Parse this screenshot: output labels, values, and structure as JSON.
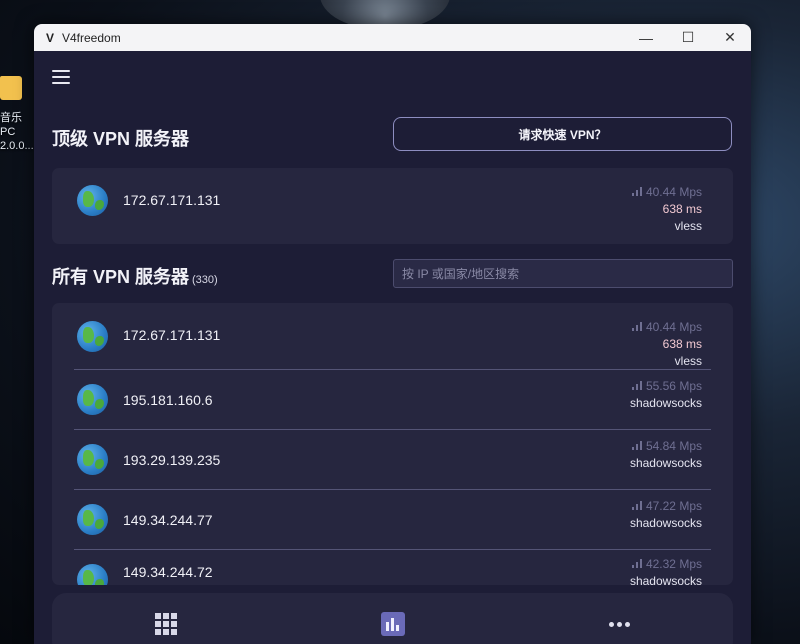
{
  "desktop": {
    "folder_label": "音乐PC 2.0.0..."
  },
  "window": {
    "title": "V4freedom",
    "logo": "V",
    "minimize": "—",
    "maximize": "☐",
    "close": "✕"
  },
  "top_section": {
    "title": "顶级 VPN 服务器",
    "quick_button": "请求快速 VPN？",
    "server": {
      "ip": "172.67.171.131",
      "speed": "40.44 Mps",
      "latency": "638 ms",
      "protocol": "vless"
    }
  },
  "all_section": {
    "title": "所有 VPN 服务器",
    "count": "(330)",
    "search_placeholder": "按 IP 或国家/地区搜索",
    "servers": [
      {
        "ip": "172.67.171.131",
        "speed": "40.44 Mps",
        "latency": "638 ms",
        "protocol": "vless"
      },
      {
        "ip": "195.181.160.6",
        "speed": "55.56 Mps",
        "protocol": "shadowsocks"
      },
      {
        "ip": "193.29.139.235",
        "speed": "54.84 Mps",
        "protocol": "shadowsocks"
      },
      {
        "ip": "149.34.244.77",
        "speed": "47.22 Mps",
        "protocol": "shadowsocks"
      },
      {
        "ip": "149.34.244.72",
        "speed": "42.32 Mps",
        "protocol": "shadowsocks"
      }
    ]
  },
  "colors": {
    "background": "#1d1d36",
    "card": "#26263f",
    "accent": "#6a6ab8",
    "latency": "#f2c9d2"
  },
  "icons": {
    "menu": "hamburger-icon",
    "server": "globe-icon",
    "speed": "signal-bars-icon",
    "nav_servers": "grid-icon",
    "nav_stats": "bar-chart-icon",
    "nav_more": "more-dots-icon"
  }
}
